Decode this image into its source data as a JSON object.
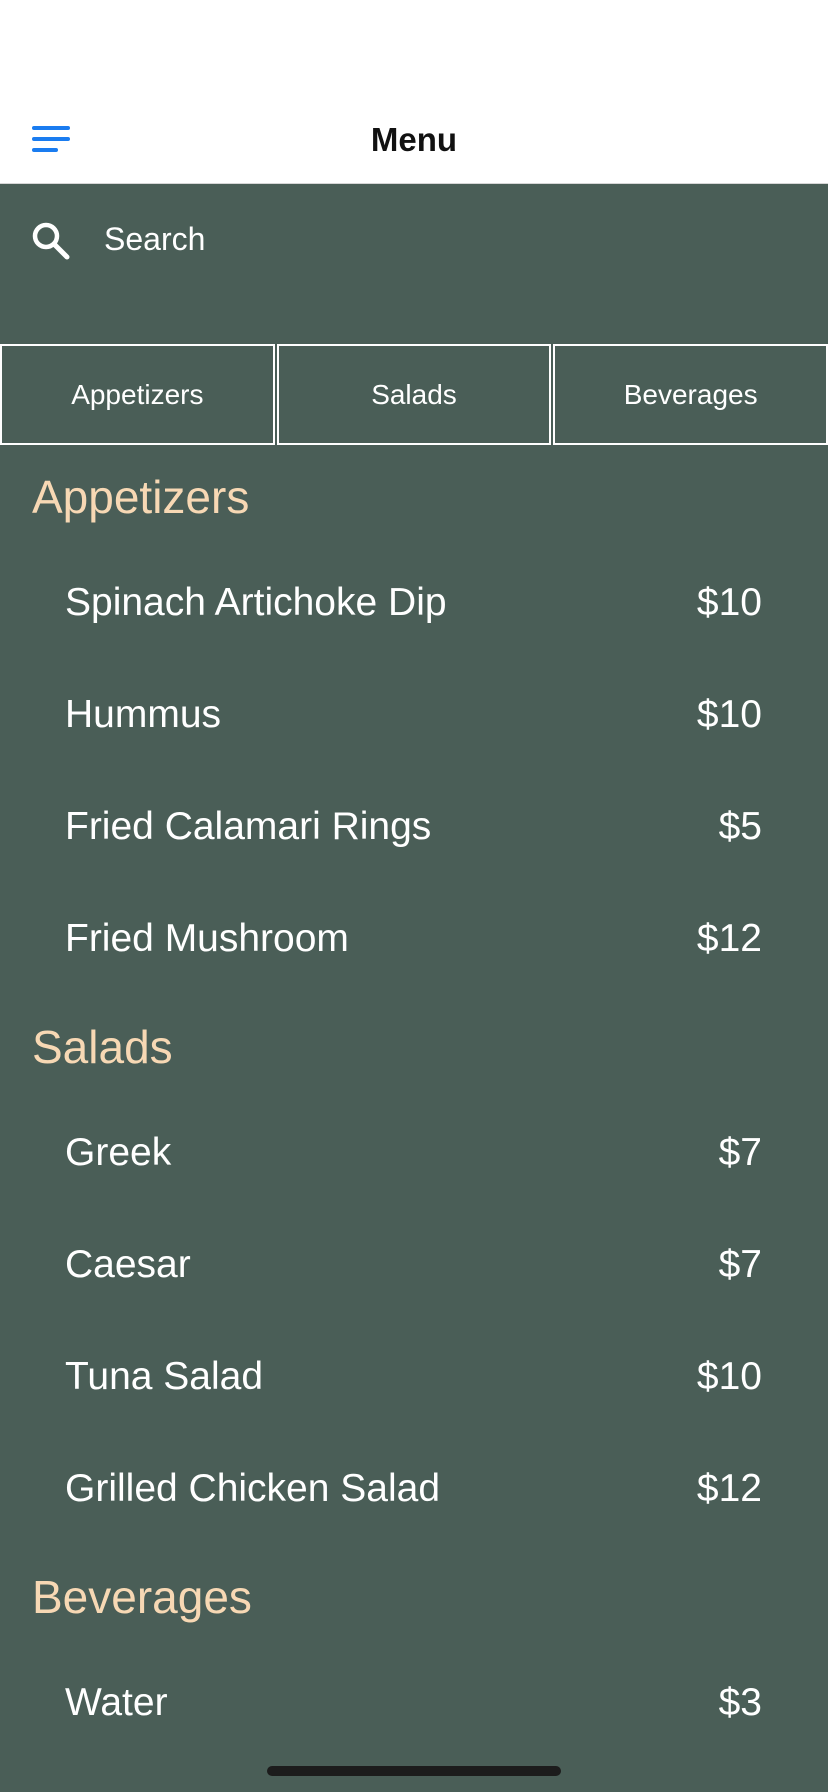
{
  "header": {
    "title": "Menu",
    "menu_icon": "hamburger-icon",
    "accent_color": "#1a7cf0"
  },
  "search": {
    "placeholder": "Search",
    "value": "",
    "icon": "search-icon"
  },
  "tabs": [
    {
      "label": "Appetizers"
    },
    {
      "label": "Salads"
    },
    {
      "label": "Beverages"
    }
  ],
  "sections": [
    {
      "title": "Appetizers",
      "items": [
        {
          "name": "Spinach Artichoke Dip",
          "price": "$10"
        },
        {
          "name": "Hummus",
          "price": "$10"
        },
        {
          "name": "Fried Calamari Rings",
          "price": "$5"
        },
        {
          "name": "Fried Mushroom",
          "price": "$12"
        }
      ]
    },
    {
      "title": "Salads",
      "items": [
        {
          "name": "Greek",
          "price": "$7"
        },
        {
          "name": "Caesar",
          "price": "$7"
        },
        {
          "name": "Tuna Salad",
          "price": "$10"
        },
        {
          "name": "Grilled Chicken Salad",
          "price": "$12"
        }
      ]
    },
    {
      "title": "Beverages",
      "items": [
        {
          "name": "Water",
          "price": "$3"
        }
      ]
    }
  ],
  "colors": {
    "background": "#4a5e57",
    "section_header": "#f7d8b4",
    "text": "#ffffff"
  }
}
